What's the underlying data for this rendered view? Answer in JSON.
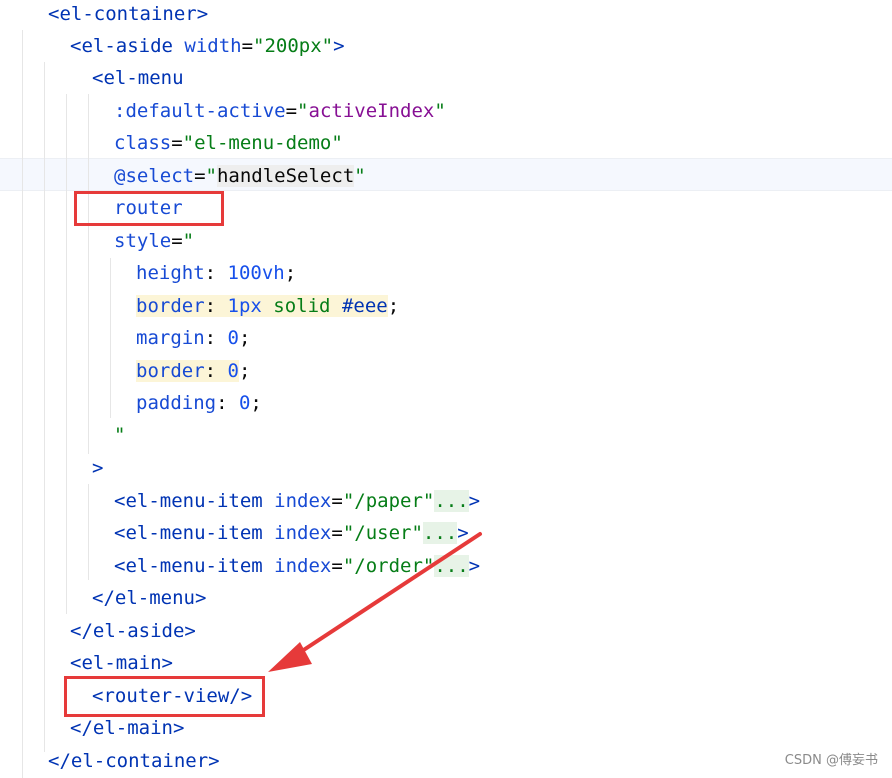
{
  "colors": {
    "tag": "#0033b3",
    "attribute": "#174ad4",
    "string": "#067d17",
    "variable": "#871094",
    "annotation_box": "#e63a3a",
    "annotation_arrow": "#e63a3a"
  },
  "code": {
    "lines": [
      {
        "tokens": [
          {
            "t": "tag",
            "v": "<el-container"
          },
          {
            "t": "tag",
            "v": ">"
          }
        ]
      },
      {
        "tokens": [
          {
            "t": "tag",
            "v": "<el-aside "
          },
          {
            "t": "attr",
            "v": "width"
          },
          {
            "t": "plain",
            "v": "="
          },
          {
            "t": "str",
            "v": "\"200px\""
          },
          {
            "t": "tag",
            "v": ">"
          }
        ]
      },
      {
        "tokens": [
          {
            "t": "tag",
            "v": "<el-menu"
          }
        ]
      },
      {
        "tokens": [
          {
            "t": "attr",
            "v": ":default-active"
          },
          {
            "t": "plain",
            "v": "="
          },
          {
            "t": "str",
            "v": "\""
          },
          {
            "t": "var",
            "v": "activeIndex"
          },
          {
            "t": "str",
            "v": "\""
          }
        ]
      },
      {
        "tokens": [
          {
            "t": "attr",
            "v": "class"
          },
          {
            "t": "plain",
            "v": "="
          },
          {
            "t": "str",
            "v": "\"el-menu-demo\""
          }
        ]
      },
      {
        "tokens": [
          {
            "t": "attr",
            "v": "@select"
          },
          {
            "t": "plain",
            "v": "="
          },
          {
            "t": "str",
            "v": "\""
          },
          {
            "t": "plain-gray",
            "v": "handleSelect"
          },
          {
            "t": "str",
            "v": "\""
          }
        ]
      },
      {
        "tokens": [
          {
            "t": "attr",
            "v": "router"
          }
        ]
      },
      {
        "tokens": [
          {
            "t": "attr",
            "v": "style"
          },
          {
            "t": "plain",
            "v": "="
          },
          {
            "t": "str",
            "v": "\""
          }
        ]
      },
      {
        "tokens": [
          {
            "t": "prop",
            "v": "height"
          },
          {
            "t": "plain",
            "v": ": "
          },
          {
            "t": "num",
            "v": "100vh"
          },
          {
            "t": "plain",
            "v": ";"
          }
        ]
      },
      {
        "tokens": [
          {
            "t": "prop-hl",
            "v": "border"
          },
          {
            "t": "plain-hl",
            "v": ": "
          },
          {
            "t": "num-hl",
            "v": "1px "
          },
          {
            "t": "str-hl",
            "v": "solid "
          },
          {
            "t": "tag-hl",
            "v": "#eee"
          },
          {
            "t": "plain",
            "v": ";"
          }
        ]
      },
      {
        "tokens": [
          {
            "t": "prop",
            "v": "margin"
          },
          {
            "t": "plain",
            "v": ": "
          },
          {
            "t": "num",
            "v": "0"
          },
          {
            "t": "plain",
            "v": ";"
          }
        ]
      },
      {
        "tokens": [
          {
            "t": "prop-hl",
            "v": "border"
          },
          {
            "t": "plain-hl",
            "v": ": "
          },
          {
            "t": "num-hl",
            "v": "0"
          },
          {
            "t": "plain",
            "v": ";"
          }
        ]
      },
      {
        "tokens": [
          {
            "t": "prop",
            "v": "padding"
          },
          {
            "t": "plain",
            "v": ": "
          },
          {
            "t": "num",
            "v": "0"
          },
          {
            "t": "plain",
            "v": ";"
          }
        ]
      },
      {
        "tokens": [
          {
            "t": "str",
            "v": "\""
          }
        ]
      },
      {
        "tokens": [
          {
            "t": "tag",
            "v": ">"
          }
        ]
      },
      {
        "tokens": [
          {
            "t": "tag",
            "v": "<el-menu-item "
          },
          {
            "t": "attr",
            "v": "index"
          },
          {
            "t": "plain",
            "v": "="
          },
          {
            "t": "str",
            "v": "\"/paper\""
          },
          {
            "t": "fold",
            "v": "..."
          },
          {
            "t": "tag",
            "v": ">"
          }
        ]
      },
      {
        "tokens": [
          {
            "t": "tag",
            "v": "<el-menu-item "
          },
          {
            "t": "attr",
            "v": "index"
          },
          {
            "t": "plain",
            "v": "="
          },
          {
            "t": "str",
            "v": "\"/user\""
          },
          {
            "t": "fold",
            "v": "..."
          },
          {
            "t": "tag",
            "v": ">"
          }
        ]
      },
      {
        "tokens": [
          {
            "t": "tag",
            "v": "<el-menu-item "
          },
          {
            "t": "attr",
            "v": "index"
          },
          {
            "t": "plain",
            "v": "="
          },
          {
            "t": "str",
            "v": "\"/order\""
          },
          {
            "t": "fold",
            "v": "..."
          },
          {
            "t": "tag",
            "v": ">"
          }
        ]
      },
      {
        "tokens": [
          {
            "t": "tag",
            "v": "</el-menu"
          },
          {
            "t": "tag",
            "v": ">"
          }
        ]
      },
      {
        "tokens": [
          {
            "t": "tag",
            "v": "</el-aside"
          },
          {
            "t": "tag",
            "v": ">"
          }
        ]
      },
      {
        "tokens": [
          {
            "t": "tag",
            "v": "<el-main"
          },
          {
            "t": "tag",
            "v": ">"
          }
        ]
      },
      {
        "tokens": [
          {
            "t": "tag",
            "v": "<router-view"
          },
          {
            "t": "tag",
            "v": "/>"
          }
        ]
      },
      {
        "tokens": [
          {
            "t": "tag",
            "v": "</el-main"
          },
          {
            "t": "tag",
            "v": ">"
          }
        ]
      },
      {
        "tokens": [
          {
            "t": "tag",
            "v": "</el-container"
          },
          {
            "t": "tag",
            "v": ">"
          }
        ]
      }
    ]
  },
  "watermark": "CSDN @傅妄书"
}
